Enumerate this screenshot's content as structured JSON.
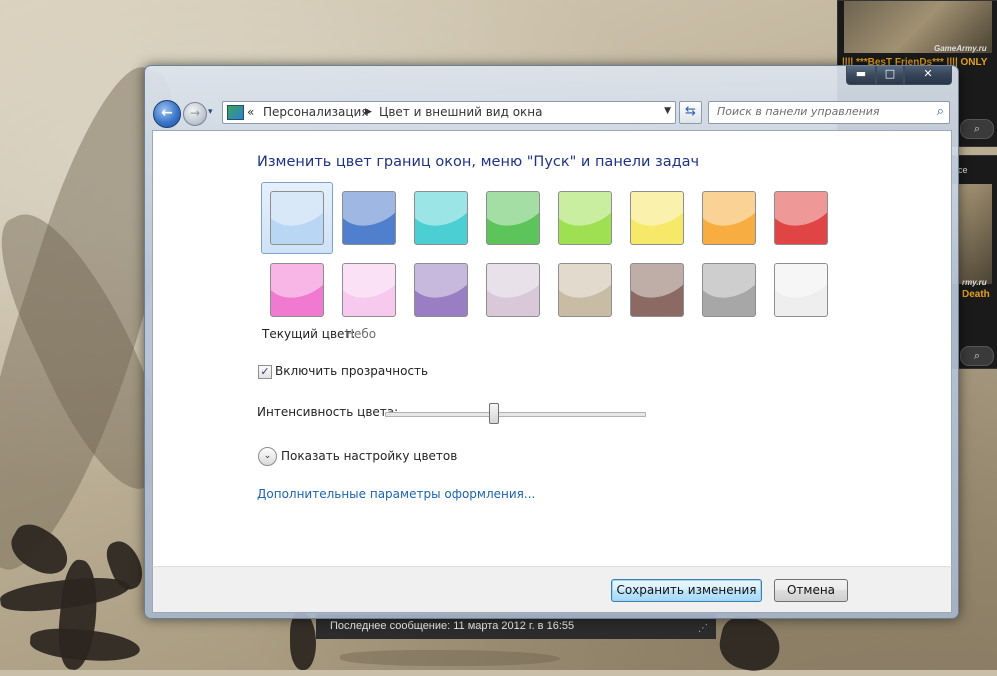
{
  "desktop": {
    "gadget1": {
      "site": "GameArmy.ru",
      "server": "|||| ***BesT FrienDs*** |||| ONLY"
    },
    "gadget2": {
      "top_text": "ce",
      "site": "rmy.ru",
      "map": "Death"
    },
    "forum_bar": {
      "last_message": "Последнее сообщение: 11 марта 2012 г. в 16:55"
    }
  },
  "window": {
    "controls": {
      "minimize": "▬",
      "maximize": "□",
      "close": "✕"
    },
    "nav": {
      "back": "←",
      "forward": "→",
      "history": "▾",
      "breadcrumb_prefix": "«",
      "breadcrumb": [
        "Персонализация",
        "Цвет и внешний вид окна"
      ],
      "separator": "▶",
      "address_dropdown": "▼",
      "refresh": "⇆"
    },
    "search": {
      "placeholder": "Поиск в панели управления",
      "icon": "⌕"
    },
    "heading": "Изменить цвет границ окон, меню \"Пуск\" и панели задач",
    "swatches": [
      {
        "color": "#b9d6f5"
      },
      {
        "color": "#4f7fcd"
      },
      {
        "color": "#4ccfd2"
      },
      {
        "color": "#5cc45a"
      },
      {
        "color": "#9ee052"
      },
      {
        "color": "#f6e869"
      },
      {
        "color": "#f7ad3f"
      },
      {
        "color": "#e04444"
      },
      {
        "color": "#f07ad0"
      },
      {
        "color": "#f7c9ef"
      },
      {
        "color": "#9a7ec4"
      },
      {
        "color": "#d8c8d8"
      },
      {
        "color": "#c8bca5"
      },
      {
        "color": "#8a6a62"
      },
      {
        "color": "#a7a7a7"
      },
      {
        "color": "#eeeeee"
      }
    ],
    "current_color_label": "Текущий цвет:",
    "current_color_value": "Небо",
    "transparency": {
      "label": "Включить прозрачность",
      "checked": true,
      "mark": "✓"
    },
    "intensity": {
      "label": "Интенсивность цвета:",
      "level_percent": 42
    },
    "expander": {
      "icon": "⌄",
      "label": "Показать настройку цветов"
    },
    "advanced_link": "Дополнительные параметры оформления...",
    "buttons": {
      "save": "Сохранить изменения",
      "cancel": "Отмена"
    }
  }
}
